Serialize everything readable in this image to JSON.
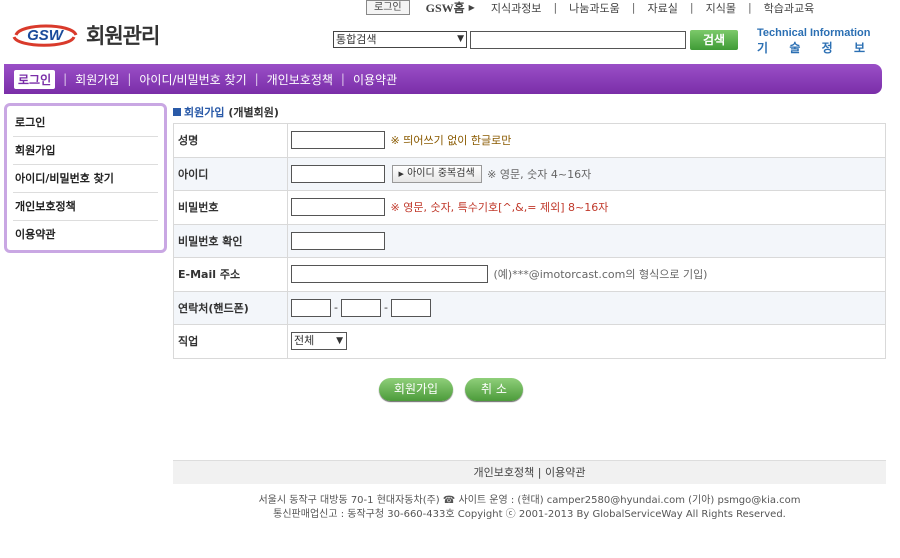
{
  "topnav": {
    "login": "로그인",
    "gsw_home": "GSW홈",
    "links": [
      "지식과정보",
      "나눔과도움",
      "자료실",
      "지식몰",
      "학습과교육"
    ]
  },
  "logo": {
    "brand": "GSW",
    "title": "회원관리"
  },
  "search": {
    "category": "통합검색",
    "query": "",
    "button": "검색"
  },
  "tech_info": {
    "en": "Technical Information",
    "kr": [
      "기",
      "술",
      "정",
      "보"
    ]
  },
  "mainnav": [
    "로그인",
    "회원가입",
    "아이디/비밀번호 찾기",
    "개인보호정책",
    "이용약관"
  ],
  "sidebar": [
    "로그인",
    "회원가입",
    "아이디/비밀번호 찾기",
    "개인보호정책",
    "이용약관"
  ],
  "content": {
    "title": "회원가입",
    "subtitle": "(개별회원)",
    "fields": {
      "name": {
        "label": "성명",
        "note": "※ 띄어쓰기 없이 한글로만"
      },
      "id": {
        "label": "아이디",
        "dup_button": "아이디 중복검색",
        "note": "※ 영문, 숫자 4~16자"
      },
      "password": {
        "label": "비밀번호",
        "note": "※ 영문, 숫자, 특수기호[^,&,= 제외] 8~16자"
      },
      "password_confirm": {
        "label": "비밀번호 확인"
      },
      "email": {
        "label": "E-Mail 주소",
        "note": "(예)***@imotorcast.com의 형식으로 기입)"
      },
      "phone": {
        "label": "연락처(핸드폰)"
      },
      "job": {
        "label": "직업",
        "selected": "전체"
      }
    },
    "buttons": {
      "join": "회원가입",
      "cancel": "취 소"
    }
  },
  "footer": {
    "links": "개인보호정책 | 이용약관",
    "line1": "서울시 동작구 대방동 70-1 현대자동차(주)  ☎ 사이트 운영 : (현대) camper2580@hyundai.com  (기아) psmgo@kia.com",
    "line2": "통신판매업신고 : 동작구청 30-660-433호 Copyight ⓒ 2001-2013 By  GlobalServiceWay All Rights Reserved."
  },
  "colors": {
    "purple": "#7a2ea8",
    "green": "#4c9b3a",
    "blue": "#2a5aa8"
  }
}
